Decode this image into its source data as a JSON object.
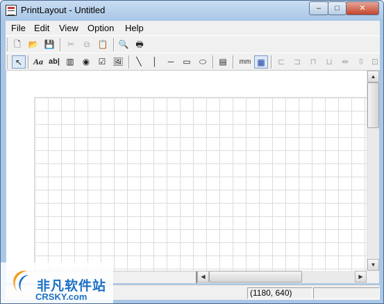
{
  "window": {
    "title": "PrintLayout - Untitled"
  },
  "caption_buttons": {
    "minimize": "–",
    "maximize": "□",
    "close": "✕"
  },
  "menu": [
    "File",
    "Edit",
    "View",
    "Option",
    "Help"
  ],
  "toolbar_standard": [
    {
      "icon": "new-document-icon",
      "glyph": "🗋"
    },
    {
      "icon": "open-folder-icon",
      "glyph": "📂"
    },
    {
      "icon": "save-icon",
      "glyph": "💾"
    },
    {
      "icon": "cut-icon",
      "glyph": "✂"
    },
    {
      "icon": "copy-icon",
      "glyph": "⧉"
    },
    {
      "icon": "paste-icon",
      "glyph": "📋"
    },
    {
      "icon": "print-preview-icon",
      "glyph": "🔍"
    },
    {
      "icon": "print-icon",
      "glyph": "🖶"
    }
  ],
  "toolbar_draw": [
    {
      "icon": "select-pointer-icon",
      "glyph": "↖"
    },
    {
      "icon": "text-font-icon",
      "glyph": "Aa"
    },
    {
      "icon": "text-field-icon",
      "glyph": "ab|"
    },
    {
      "icon": "barcode-icon",
      "glyph": "▥"
    },
    {
      "icon": "radio-button-icon",
      "glyph": "◉"
    },
    {
      "icon": "checkbox-icon",
      "glyph": "☑"
    },
    {
      "icon": "image-icon",
      "glyph": "🖼"
    },
    {
      "icon": "diagonal-line-icon",
      "glyph": "╲"
    },
    {
      "icon": "vertical-line-icon",
      "glyph": "│"
    },
    {
      "icon": "horizontal-line-icon",
      "glyph": "─"
    },
    {
      "icon": "rectangle-icon",
      "glyph": "▭"
    },
    {
      "icon": "ellipse-icon",
      "glyph": "⬭"
    },
    {
      "icon": "table-icon",
      "glyph": "▤"
    },
    {
      "icon": "units-mm-icon",
      "glyph": "mm"
    },
    {
      "icon": "grid-toggle-icon",
      "glyph": "▦"
    },
    {
      "icon": "align-left-icon",
      "glyph": "⊏"
    },
    {
      "icon": "align-right-icon",
      "glyph": "⊐"
    },
    {
      "icon": "align-top-icon",
      "glyph": "⊓"
    },
    {
      "icon": "align-bottom-icon",
      "glyph": "⊔"
    },
    {
      "icon": "center-horizontal-icon",
      "glyph": "⇹"
    },
    {
      "icon": "center-vertical-icon",
      "glyph": "⇳"
    },
    {
      "icon": "same-size-icon",
      "glyph": "⊡"
    }
  ],
  "status": {
    "coordinates": "(1180, 640)",
    "extra": ""
  },
  "watermark": {
    "chinese": "非凡软件站",
    "english": "CRSKY.com"
  }
}
